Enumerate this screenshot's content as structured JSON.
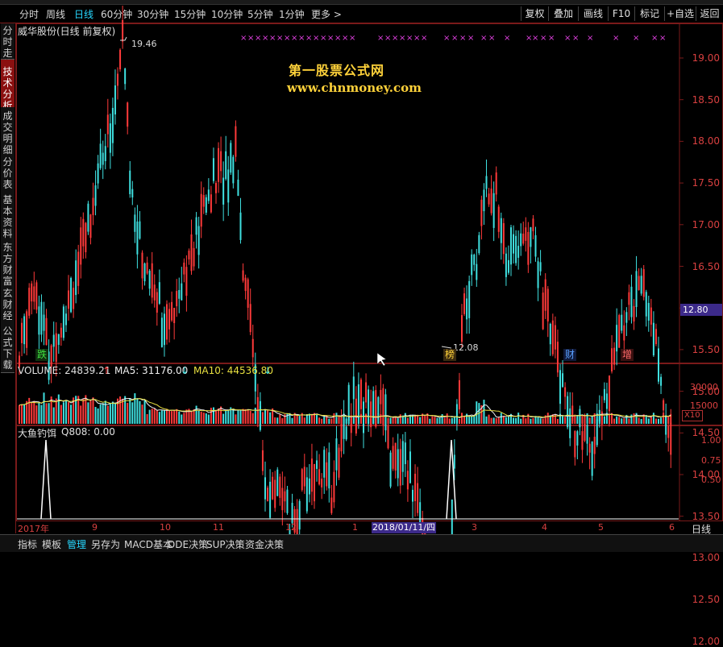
{
  "period_tabs": [
    {
      "label": "分时",
      "active": false
    },
    {
      "label": "周线",
      "active": false
    },
    {
      "label": "日线",
      "active": true
    },
    {
      "label": "60分钟",
      "active": false
    },
    {
      "label": "30分钟",
      "active": false
    },
    {
      "label": "15分钟",
      "active": false
    },
    {
      "label": "10分钟",
      "active": false
    },
    {
      "label": "5分钟",
      "active": false
    },
    {
      "label": "1分钟",
      "active": false
    },
    {
      "label": "更多 >",
      "active": false
    }
  ],
  "right_buttons": [
    "复权",
    "叠加",
    "画线",
    "F10",
    "标记",
    "+自选",
    "返回"
  ],
  "side_tabs": [
    {
      "label": "分时走势",
      "active": false
    },
    {
      "label": "技术分析",
      "active": true
    },
    {
      "label": "成交明细",
      "active": false
    },
    {
      "label": "分价表",
      "active": false
    },
    {
      "label": "基本资料",
      "active": false
    },
    {
      "label": "东方财富",
      "active": false
    },
    {
      "label": "玄财经",
      "active": false
    },
    {
      "label": "公式下载",
      "active": false
    }
  ],
  "main_chart": {
    "title": "威华股份(日线 前复权)",
    "watermark_title": "第一股票公式网",
    "watermark_url": "www.chnmoney.com",
    "high_label": "19.46",
    "low_label": "12.08",
    "last_price": "12.80",
    "y_ticks": [
      "19.00",
      "18.50",
      "18.00",
      "17.50",
      "17.00",
      "16.50",
      "16.00",
      "15.50",
      "15.00",
      "14.50",
      "14.00",
      "13.50",
      "13.00",
      "12.50",
      "12.00"
    ],
    "colors": {
      "up": "#ff3a3a",
      "down": "#3fe0e0",
      "star": "#e040e0"
    }
  },
  "events": [
    {
      "label": "跌",
      "color": "#40e040"
    },
    {
      "label": "榜",
      "color": "#ffd23a"
    },
    {
      "label": "财",
      "color": "#5aa0ff"
    },
    {
      "label": "增",
      "color": "#ff6a6a"
    }
  ],
  "volume_panel": {
    "vol_label": "VOLUME: 24839.21",
    "ma5_label": "MA5: 31176.00",
    "ma10_label": "MA10: 44536.80",
    "y_ticks": [
      "30000",
      "15000"
    ],
    "unit": "X10"
  },
  "indicator_panel": {
    "name": "大鱼钓饵",
    "q_label": "Q808: 0.00",
    "y_ticks": [
      "1.00",
      "0.75",
      "0.50"
    ]
  },
  "x_axis": {
    "labels": [
      "2017年",
      "9",
      "10",
      "11",
      "12",
      "1",
      "3",
      "4",
      "5",
      "6"
    ],
    "cursor_date": "2018/01/11/四",
    "period_label": "日线"
  },
  "bottom_tabs": [
    {
      "label": "指标",
      "active": false
    },
    {
      "label": "模板",
      "active": false
    },
    {
      "label": "管理",
      "active": true
    },
    {
      "label": "另存为",
      "active": false
    },
    {
      "label": "MACD基本",
      "active": false
    },
    {
      "label": "DDE决策",
      "active": false
    },
    {
      "label": "SUP决策",
      "active": false
    },
    {
      "label": "资金决策",
      "active": false
    }
  ]
}
